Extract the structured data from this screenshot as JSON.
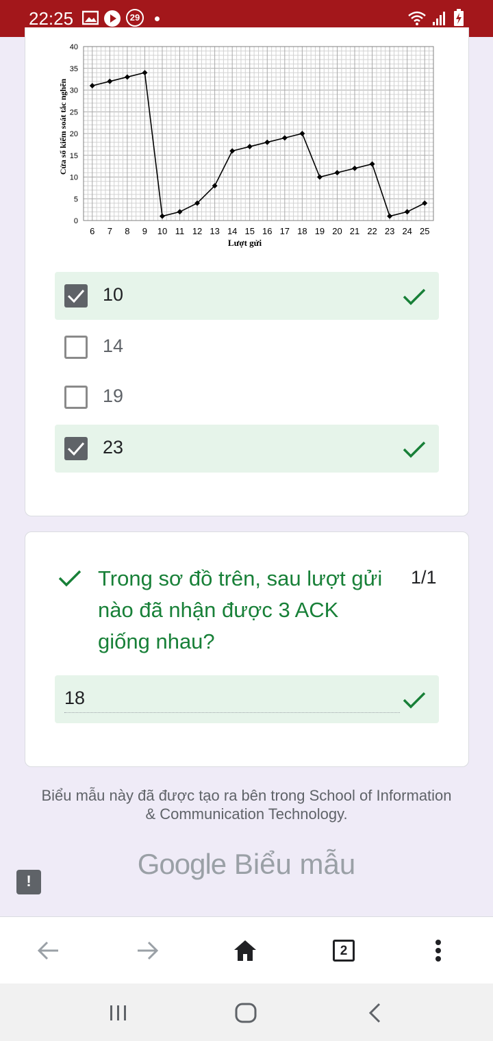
{
  "status_bar": {
    "time": "22:25",
    "notification_count": "29",
    "icons": [
      "image-icon",
      "play-icon",
      "notification-badge-icon",
      "dot-icon",
      "wifi-icon",
      "signal-icon",
      "battery-charging-icon"
    ]
  },
  "chart_data": {
    "type": "line",
    "x": [
      6,
      7,
      8,
      9,
      10,
      11,
      12,
      13,
      14,
      15,
      16,
      17,
      18,
      19,
      20,
      21,
      22,
      23,
      24,
      25
    ],
    "series": [
      {
        "values": [
          31,
          32,
          33,
          34,
          1,
          2,
          4,
          8,
          16,
          17,
          18,
          19,
          20,
          10,
          11,
          12,
          13,
          1,
          2,
          4
        ]
      }
    ],
    "xlabel": "Lượt gửi",
    "ylabel": "Cửa sổ kiểm soát tắc nghẽn",
    "xticks": [
      "6",
      "7",
      "8",
      "9",
      "10",
      "11",
      "12",
      "13",
      "14",
      "15",
      "16",
      "17",
      "18",
      "19",
      "20",
      "21",
      "22",
      "23",
      "24",
      "25"
    ],
    "yticks": [
      "0",
      "5",
      "10",
      "15",
      "20",
      "25",
      "30",
      "35",
      "40"
    ],
    "ylim": [
      0,
      40
    ],
    "grid": true,
    "marker": "diamond",
    "color": "#000000"
  },
  "question1": {
    "options": [
      {
        "label": "10",
        "checked": true,
        "correct": true
      },
      {
        "label": "14",
        "checked": false,
        "correct": false
      },
      {
        "label": "19",
        "checked": false,
        "correct": false
      },
      {
        "label": "23",
        "checked": true,
        "correct": true
      }
    ]
  },
  "question2": {
    "text": "Trong sơ đồ trên, sau lượt gửi nào đã nhận được 3 ACK giống nhau?",
    "score": "1/1",
    "answer": "18"
  },
  "footer": {
    "text": "Biểu mẫu này đã được tạo ra bên trong School of Information & Communication Technology.",
    "brand_google": "Google",
    "brand_forms": "Biểu mẫu",
    "report_label": "!"
  },
  "browser": {
    "tab_count": "2"
  },
  "colors": {
    "status_bar": "#a3171b",
    "correct_green": "#188038",
    "correct_bg": "#e6f4ea",
    "page_bg": "#efebf7"
  }
}
